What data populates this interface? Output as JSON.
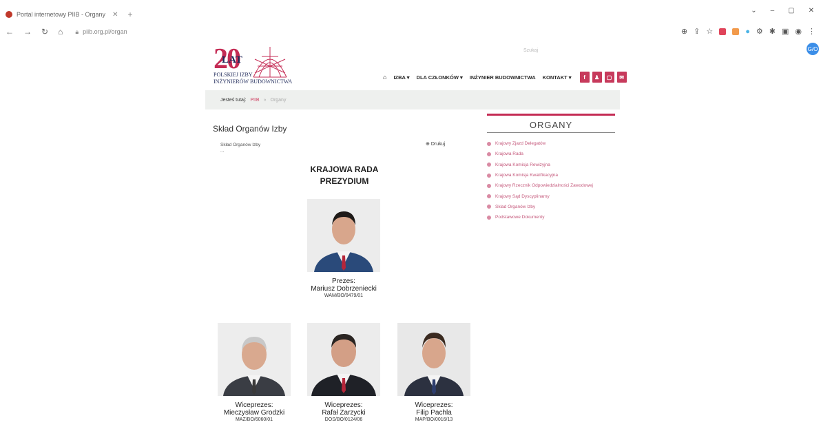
{
  "browser": {
    "tab_title": "Portal internetowy PIIB - Organy",
    "close_glyph": "✕",
    "new_tab_glyph": "+",
    "url": "piib.org.pl/organ",
    "profile_badge": "G/O"
  },
  "logo": {
    "number": "20",
    "lat": "LAT",
    "line1": "POLSKIEJ IZBY",
    "line2": "INŻYNIERÓW BUDOWNICTWA"
  },
  "search_hint": "Szukaj",
  "nav": {
    "items": [
      "IZBA",
      "DLA CZŁONKÓW",
      "INŻYNIER BUDOWNICTWA",
      "KONTAKT"
    ],
    "social": [
      "f",
      "♟",
      "▢",
      "✉"
    ]
  },
  "breadcrumb": {
    "prefix": "Jesteś tutaj:",
    "link": "PIIB",
    "current": "Organy"
  },
  "content": {
    "page_title": "Skład Organów Izby",
    "toc": [
      "Skład Organów Izby",
      "..."
    ],
    "print_label": "Drukuj",
    "section_title_1": "KRAJOWA RADA",
    "section_title_2": "PREZYDIUM"
  },
  "people": [
    {
      "role": "Prezes:",
      "name": "Mariusz Dobrzeniecki",
      "id": "WAM/BO/0479/01",
      "tie": "#b5263a"
    },
    {
      "role": "Wiceprezes:",
      "name": "Mieczysław Grodzki",
      "id": "MAZ/BO/6060/01",
      "tie": "#3a3a3a"
    },
    {
      "role": "Wiceprezes:",
      "name": "Rafał Zarzycki",
      "id": "DOS/BO/0124/06",
      "tie": "#b5263a"
    },
    {
      "role": "Wiceprezes:",
      "name": "Filip Pachla",
      "id": "MAP/BO/0016/13",
      "tie": "#2e3e6e"
    }
  ],
  "sidebar": {
    "title": "ORGANY",
    "items": [
      "Krajowy Zjazd Delegatów",
      "Krajowa Rada",
      "Krajowa Komisja Rewizyjna",
      "Krajowa Komisja Kwalifikacyjna",
      "Krajowy Rzecznik Odpowiedzialności Zawodowej",
      "Krajowy Sąd Dyscyplinarny",
      "Skład Organów Izby",
      "Podstawowe Dokumenty"
    ]
  },
  "colors": {
    "accent": "#c42b54",
    "navy": "#1f2a5a"
  }
}
